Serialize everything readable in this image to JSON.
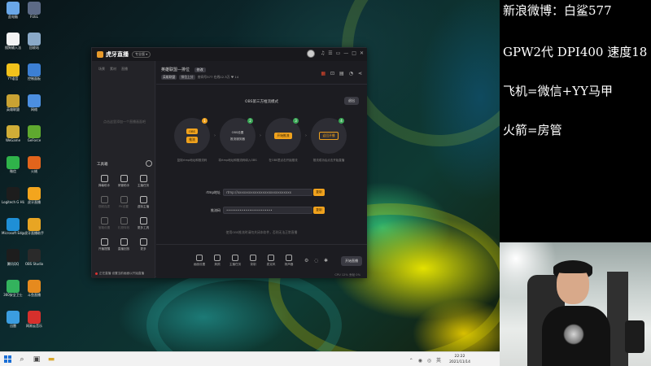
{
  "desktop": {
    "icons": [
      {
        "label": "此电脑",
        "color": "#6aa7e8"
      },
      {
        "label": "FUEL",
        "color": "#5c6a86"
      },
      {
        "label": "搜狗输入法",
        "color": "#f3f3f3"
      },
      {
        "label": "回收站",
        "color": "#8aa9c8"
      },
      {
        "label": "YY语音",
        "color": "#f2c21b"
      },
      {
        "label": "控制面板",
        "color": "#3c7fd3"
      },
      {
        "label": "英雄联盟",
        "color": "#c9a233"
      },
      {
        "label": "网络",
        "color": "#4c8fe0"
      },
      {
        "label": "WeGame",
        "color": "#d0ad37"
      },
      {
        "label": "GeForce",
        "color": "#5fa92f"
      },
      {
        "label": "微信",
        "color": "#2fb34a"
      },
      {
        "label": "火绒",
        "color": "#e2641c"
      },
      {
        "label": "Logitech G HUB",
        "color": "#1d1d1d"
      },
      {
        "label": "虎牙直播",
        "color": "#f3a51d"
      },
      {
        "label": "Microsoft Edge",
        "color": "#1f8fd6"
      },
      {
        "label": "虎牙直播助手",
        "color": "#e8a523"
      },
      {
        "label": "腾讯QQ",
        "color": "#1d1d1d"
      },
      {
        "label": "OBS Studio",
        "color": "#2a2a2a"
      },
      {
        "label": "360安全卫士",
        "color": "#33b35d"
      },
      {
        "label": "斗鱼直播",
        "color": "#e68a1e"
      },
      {
        "label": "迅雷",
        "color": "#3b9de0"
      },
      {
        "label": "网易云音乐",
        "color": "#d7302c"
      }
    ]
  },
  "taskbar": {
    "time": "22:22",
    "date": "2021/11/14"
  },
  "app": {
    "name": "虎牙直播",
    "badge": "专业版 ▾",
    "window_controls": [
      "♫",
      "☰",
      "▭",
      "—",
      "□",
      "✕"
    ],
    "sidebar": {
      "tabs": [
        "场景",
        "素材",
        "直播"
      ],
      "empty_hint": "点击这里添加一个直播画面吧",
      "tools_title": "工具箱",
      "tools": [
        {
          "label": "弹幕助手",
          "dim": false
        },
        {
          "label": "房管助手",
          "dim": false
        },
        {
          "label": "主播任务",
          "dim": false
        },
        {
          "label": "视频连麦",
          "dim": true
        },
        {
          "label": "PK设置",
          "dim": true
        },
        {
          "label": "虚拟主播",
          "dim": false
        },
        {
          "label": "宝箱设置",
          "dim": true
        },
        {
          "label": "礼物特效",
          "dim": true
        },
        {
          "label": "更多工具",
          "dim": false
        },
        {
          "label": "开播提醒",
          "dim": false
        },
        {
          "label": "直播回放",
          "dim": false
        },
        {
          "label": "更多",
          "dim": false
        }
      ],
      "footer": "正在直播  设置当前画面以开始直播"
    },
    "main": {
      "room_title": "英雄联盟—排位",
      "room_tag": "修改",
      "meta": [
        "英雄联盟",
        "排位上分",
        "房间号577",
        "在线12.3万",
        "♥ 14"
      ],
      "mode_title": "OBS第三方推流模式",
      "exit_label": "退出",
      "steps": [
        {
          "num": "1",
          "num_color": "#f0a21d",
          "boxes": [
            "OBS",
            "推流"
          ],
          "desc": "复制rtmp地址和推流码"
        },
        {
          "num": "2",
          "num_color": "#3aa655",
          "boxes": [
            "OBS设置",
            "推流服务器"
          ],
          "desc": "将rtmp地址和推流码填入OBS"
        },
        {
          "num": "3",
          "num_color": "#3aa655",
          "boxes": [
            "开始推流"
          ],
          "desc": "在OBS里点击开始推流"
        },
        {
          "num": "4",
          "num_color": "#3aa655",
          "boxes": [
            "返回开播"
          ],
          "desc": "推流成功后点击开始直播"
        }
      ],
      "rtmp_label": "rtmp地址",
      "rtmp_value": "rtmp://xxxxxxxxxxxxxxxxxxxxxxxxxxxx",
      "key_label": "推流码",
      "key_value": "••••••••••••••••••••••••",
      "copy_label": "复制",
      "hint": "使用OBS推流时请勿关闭本软件，否则无法正常直播",
      "bottom_items": [
        "画面设置",
        "美颜",
        "主播任务",
        "录制",
        "麦克风",
        "扬声器"
      ],
      "start_label": "开始直播",
      "bottom_meta": "CPU 12%  丢帧 0%"
    }
  },
  "overlay": {
    "lines": [
      "新浪微博：白鲨577",
      "GPW2代 DPI400 速度18",
      "飞机=微信+YY马甲",
      "火箭=房管"
    ]
  }
}
